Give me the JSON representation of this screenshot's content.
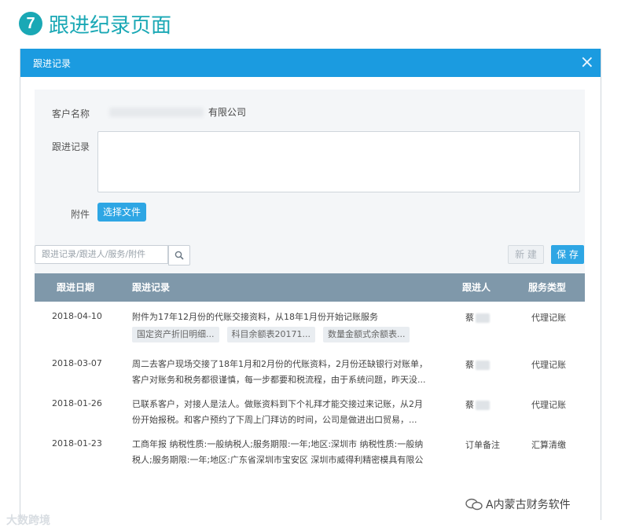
{
  "heading": {
    "number": "7",
    "text": "跟进纪录页面"
  },
  "modal": {
    "title": "跟进记录",
    "close_icon": "×",
    "form": {
      "customer_label": "客户名称",
      "customer_value_visible": "有限公司",
      "record_label": "跟进记录",
      "record_value": "",
      "attachment_label": "附件",
      "choose_file_label": "选择文件"
    },
    "toolbar": {
      "search_placeholder": "跟进记录/跟进人/服务/附件",
      "new_label": "新 建",
      "save_label": "保 存"
    },
    "table": {
      "headers": [
        "跟进日期",
        "跟进记录",
        "跟进人",
        "服务类型"
      ],
      "rows": [
        {
          "date": "2018-04-10",
          "record": "附件为17年12月份的代账交接资料，从18年1月份开始记账服务",
          "attachments": [
            "国定资产折旧明细...",
            "科目余额表20171...",
            "数量金额式余额表..."
          ],
          "person": "蔡",
          "service": "代理记账"
        },
        {
          "date": "2018-03-07",
          "record": "周二去客户现场交接了18年1月和2月份的代账资料，2月份还缺银行对账单，客户对账务和税务都很谨慎，每一步都要和税流程，由于系统问题，昨天没...",
          "attachments": [],
          "person": "蔡",
          "service": "代理记账"
        },
        {
          "date": "2018-01-26",
          "record": "已联系客户，对接人是法人。做账资料到下个礼拜才能交接过来记账，从2月份开始报税。和客户预约了下周上门拜访的时间，公司是做进出口贸易，...",
          "attachments": [],
          "person": "蔡",
          "service": "代理记账"
        },
        {
          "date": "2018-01-23",
          "record": "工商年报 纳税性质:一般纳税人;服务期限:一年;地区:深圳市 纳税性质:一般纳税人;服务期限:一年;地区:广东省深圳市宝安区 深圳市威得利精密模具有限公司...",
          "attachments": [],
          "person": "订单备注",
          "service": "汇算清缴"
        }
      ]
    }
  },
  "watermarks": {
    "left": "大数跨境",
    "right": "A内蒙古财务软件"
  }
}
